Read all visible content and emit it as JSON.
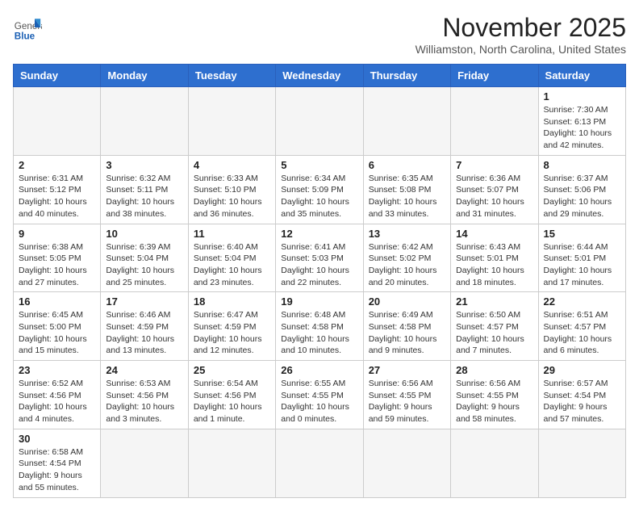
{
  "header": {
    "logo": {
      "line1": "General",
      "line2": "Blue"
    },
    "title": "November 2025",
    "location": "Williamston, North Carolina, United States"
  },
  "weekdays": [
    "Sunday",
    "Monday",
    "Tuesday",
    "Wednesday",
    "Thursday",
    "Friday",
    "Saturday"
  ],
  "weeks": [
    [
      {
        "day": "",
        "info": ""
      },
      {
        "day": "",
        "info": ""
      },
      {
        "day": "",
        "info": ""
      },
      {
        "day": "",
        "info": ""
      },
      {
        "day": "",
        "info": ""
      },
      {
        "day": "",
        "info": ""
      },
      {
        "day": "1",
        "info": "Sunrise: 7:30 AM\nSunset: 6:13 PM\nDaylight: 10 hours\nand 42 minutes."
      }
    ],
    [
      {
        "day": "2",
        "info": "Sunrise: 6:31 AM\nSunset: 5:12 PM\nDaylight: 10 hours\nand 40 minutes."
      },
      {
        "day": "3",
        "info": "Sunrise: 6:32 AM\nSunset: 5:11 PM\nDaylight: 10 hours\nand 38 minutes."
      },
      {
        "day": "4",
        "info": "Sunrise: 6:33 AM\nSunset: 5:10 PM\nDaylight: 10 hours\nand 36 minutes."
      },
      {
        "day": "5",
        "info": "Sunrise: 6:34 AM\nSunset: 5:09 PM\nDaylight: 10 hours\nand 35 minutes."
      },
      {
        "day": "6",
        "info": "Sunrise: 6:35 AM\nSunset: 5:08 PM\nDaylight: 10 hours\nand 33 minutes."
      },
      {
        "day": "7",
        "info": "Sunrise: 6:36 AM\nSunset: 5:07 PM\nDaylight: 10 hours\nand 31 minutes."
      },
      {
        "day": "8",
        "info": "Sunrise: 6:37 AM\nSunset: 5:06 PM\nDaylight: 10 hours\nand 29 minutes."
      }
    ],
    [
      {
        "day": "9",
        "info": "Sunrise: 6:38 AM\nSunset: 5:05 PM\nDaylight: 10 hours\nand 27 minutes."
      },
      {
        "day": "10",
        "info": "Sunrise: 6:39 AM\nSunset: 5:04 PM\nDaylight: 10 hours\nand 25 minutes."
      },
      {
        "day": "11",
        "info": "Sunrise: 6:40 AM\nSunset: 5:04 PM\nDaylight: 10 hours\nand 23 minutes."
      },
      {
        "day": "12",
        "info": "Sunrise: 6:41 AM\nSunset: 5:03 PM\nDaylight: 10 hours\nand 22 minutes."
      },
      {
        "day": "13",
        "info": "Sunrise: 6:42 AM\nSunset: 5:02 PM\nDaylight: 10 hours\nand 20 minutes."
      },
      {
        "day": "14",
        "info": "Sunrise: 6:43 AM\nSunset: 5:01 PM\nDaylight: 10 hours\nand 18 minutes."
      },
      {
        "day": "15",
        "info": "Sunrise: 6:44 AM\nSunset: 5:01 PM\nDaylight: 10 hours\nand 17 minutes."
      }
    ],
    [
      {
        "day": "16",
        "info": "Sunrise: 6:45 AM\nSunset: 5:00 PM\nDaylight: 10 hours\nand 15 minutes."
      },
      {
        "day": "17",
        "info": "Sunrise: 6:46 AM\nSunset: 4:59 PM\nDaylight: 10 hours\nand 13 minutes."
      },
      {
        "day": "18",
        "info": "Sunrise: 6:47 AM\nSunset: 4:59 PM\nDaylight: 10 hours\nand 12 minutes."
      },
      {
        "day": "19",
        "info": "Sunrise: 6:48 AM\nSunset: 4:58 PM\nDaylight: 10 hours\nand 10 minutes."
      },
      {
        "day": "20",
        "info": "Sunrise: 6:49 AM\nSunset: 4:58 PM\nDaylight: 10 hours\nand 9 minutes."
      },
      {
        "day": "21",
        "info": "Sunrise: 6:50 AM\nSunset: 4:57 PM\nDaylight: 10 hours\nand 7 minutes."
      },
      {
        "day": "22",
        "info": "Sunrise: 6:51 AM\nSunset: 4:57 PM\nDaylight: 10 hours\nand 6 minutes."
      }
    ],
    [
      {
        "day": "23",
        "info": "Sunrise: 6:52 AM\nSunset: 4:56 PM\nDaylight: 10 hours\nand 4 minutes."
      },
      {
        "day": "24",
        "info": "Sunrise: 6:53 AM\nSunset: 4:56 PM\nDaylight: 10 hours\nand 3 minutes."
      },
      {
        "day": "25",
        "info": "Sunrise: 6:54 AM\nSunset: 4:56 PM\nDaylight: 10 hours\nand 1 minute."
      },
      {
        "day": "26",
        "info": "Sunrise: 6:55 AM\nSunset: 4:55 PM\nDaylight: 10 hours\nand 0 minutes."
      },
      {
        "day": "27",
        "info": "Sunrise: 6:56 AM\nSunset: 4:55 PM\nDaylight: 9 hours\nand 59 minutes."
      },
      {
        "day": "28",
        "info": "Sunrise: 6:56 AM\nSunset: 4:55 PM\nDaylight: 9 hours\nand 58 minutes."
      },
      {
        "day": "29",
        "info": "Sunrise: 6:57 AM\nSunset: 4:54 PM\nDaylight: 9 hours\nand 57 minutes."
      }
    ],
    [
      {
        "day": "30",
        "info": "Sunrise: 6:58 AM\nSunset: 4:54 PM\nDaylight: 9 hours\nand 55 minutes."
      },
      {
        "day": "",
        "info": ""
      },
      {
        "day": "",
        "info": ""
      },
      {
        "day": "",
        "info": ""
      },
      {
        "day": "",
        "info": ""
      },
      {
        "day": "",
        "info": ""
      },
      {
        "day": "",
        "info": ""
      }
    ]
  ]
}
